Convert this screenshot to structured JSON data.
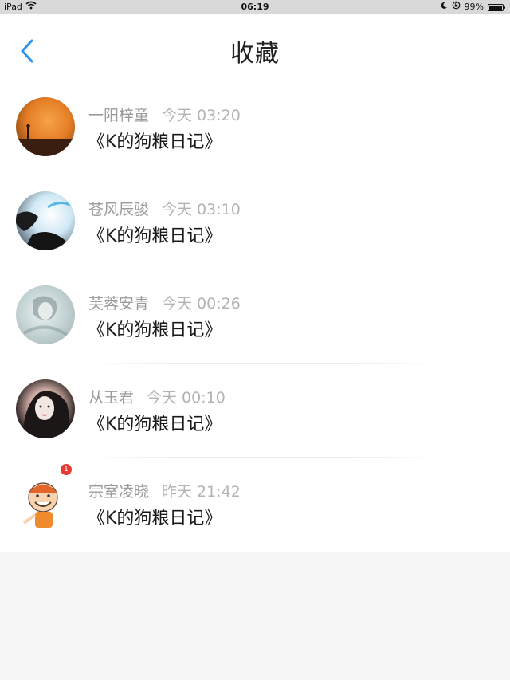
{
  "status": {
    "device": "iPad",
    "time": "06:19",
    "battery": "99%"
  },
  "header": {
    "title": "收藏"
  },
  "items": [
    {
      "author": "一阳梓童",
      "time": "今天 03:20",
      "title": "《K的狗粮日记》",
      "avatar": "avatar-sunset"
    },
    {
      "author": "苍风辰骏",
      "time": "今天 03:10",
      "title": "《K的狗粮日记》",
      "avatar": "avatar-sketch"
    },
    {
      "author": "芙蓉安青",
      "time": "今天 00:26",
      "title": "《K的狗粮日记》",
      "avatar": "avatar-pale"
    },
    {
      "author": "从玉君",
      "time": "今天 00:10",
      "title": "《K的狗粮日记》",
      "avatar": "avatar-portrait"
    },
    {
      "author": "宗室凌晓",
      "time": "昨天 21:42",
      "title": "《K的狗粮日记》",
      "avatar": "avatar-cartoon",
      "badge": "1"
    }
  ],
  "colors": {
    "accent": "#2f95e8",
    "background": "#f6f6f7"
  }
}
